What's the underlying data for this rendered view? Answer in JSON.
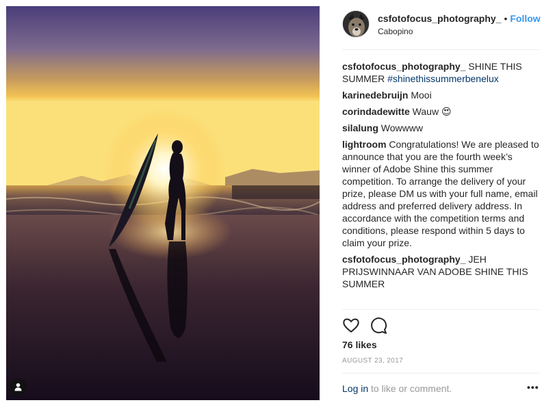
{
  "post": {
    "username": "csfotofocus_photography_",
    "separator": "•",
    "follow_label": "Follow",
    "location": "Cabopino",
    "likes": "76 likes",
    "date": "AUGUST 23, 2017"
  },
  "comments": [
    {
      "user": "csfotofocus_photography_",
      "text": " SHINE THIS SUMMER ",
      "tag": "#shinethissummerbenelux"
    },
    {
      "user": "karinedebruijn",
      "text": " Mooi"
    },
    {
      "user": "corindadewitte",
      "text": " Wauw ",
      "emoji": "😍"
    },
    {
      "user": "silalung",
      "text": " Wowwww"
    },
    {
      "user": "lightroom",
      "text": " Congratulations! We are pleased to announce that you are the fourth week’s winner of Adobe Shine this summer competition. To arrange the delivery of your prize, please DM us with your full name, email address and preferred delivery address. In accordance with the competition terms and conditions, please respond within 5 days to claim your prize."
    },
    {
      "user": "csfotofocus_photography_",
      "text": " JEH PRIJSWINNAAR VAN ADOBE SHINE THIS SUMMER"
    }
  ],
  "footer": {
    "login_link": "Log in",
    "login_rest": " to like or comment.",
    "more_label": "•••"
  },
  "icons": {
    "like": "heart-icon",
    "comment": "comment-bubble-icon",
    "user_tag": "user-tag-icon",
    "more": "more-options-icon"
  },
  "colors": {
    "follow": "#3897f0",
    "link": "#003569",
    "muted": "#999999",
    "text": "#262626"
  }
}
